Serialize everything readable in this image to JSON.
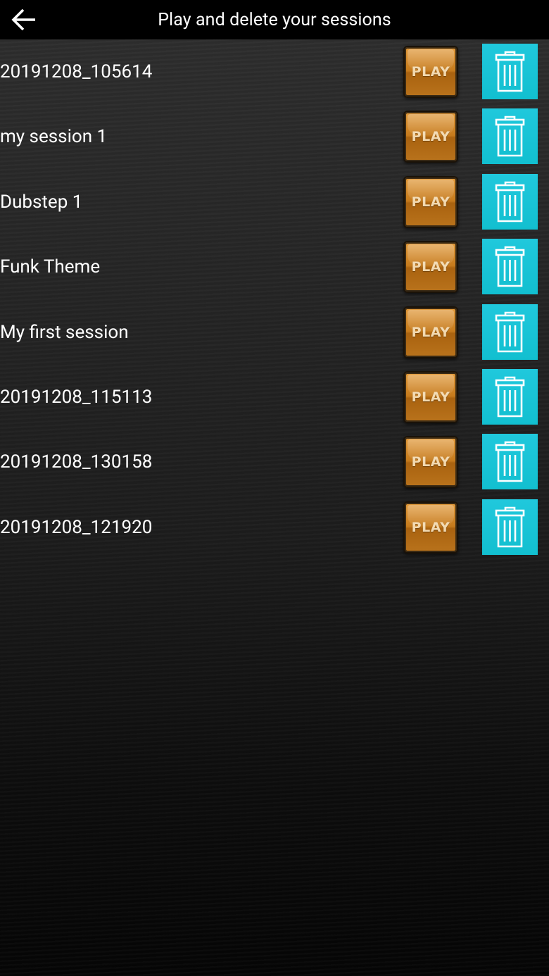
{
  "header": {
    "back_icon": "arrow-left-icon",
    "title": "Play and delete your sessions"
  },
  "sessions": [
    {
      "name": "20191208_105614",
      "play_label": "PLAY",
      "delete_icon": "trash-icon"
    },
    {
      "name": "my session 1",
      "play_label": "PLAY",
      "delete_icon": "trash-icon"
    },
    {
      "name": "Dubstep 1",
      "play_label": "PLAY",
      "delete_icon": "trash-icon"
    },
    {
      "name": "Funk Theme",
      "play_label": "PLAY",
      "delete_icon": "trash-icon"
    },
    {
      "name": "My first session",
      "play_label": "PLAY",
      "delete_icon": "trash-icon"
    },
    {
      "name": "20191208_115113",
      "play_label": "PLAY",
      "delete_icon": "trash-icon"
    },
    {
      "name": "20191208_130158",
      "play_label": "PLAY",
      "delete_icon": "trash-icon"
    },
    {
      "name": "20191208_121920",
      "play_label": "PLAY",
      "delete_icon": "trash-icon"
    }
  ],
  "colors": {
    "toolbar": "#000000",
    "play_button": "#c57a1c",
    "delete_button": "#12bfd0",
    "text": "#ffffff"
  }
}
